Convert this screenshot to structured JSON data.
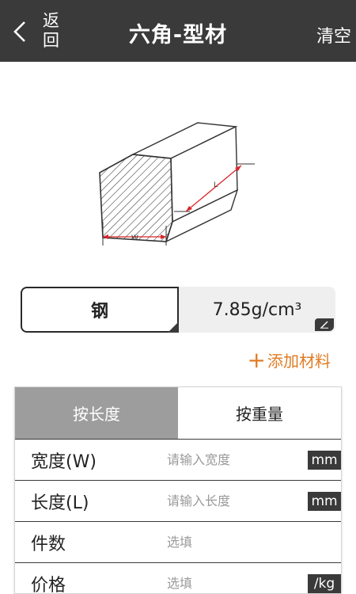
{
  "header": {
    "back_label": "返回",
    "title": "六角-型材",
    "clear_label": "清空"
  },
  "diagram": {
    "width_label": "W",
    "length_label": "L"
  },
  "material": {
    "name": "钢",
    "density": "7.85g/cm³"
  },
  "add_material_label": "添加材料",
  "tabs": [
    {
      "label": "按长度",
      "active": true
    },
    {
      "label": "按重量",
      "active": false
    }
  ],
  "fields": [
    {
      "label": "宽度(W)",
      "placeholder": "请输入宽度",
      "unit": "mm"
    },
    {
      "label": "长度(L)",
      "placeholder": "请输入长度",
      "unit": "mm"
    },
    {
      "label": "件数",
      "placeholder": "选填"
    },
    {
      "label": "价格",
      "placeholder": "选填",
      "unit": "/kg"
    }
  ],
  "colors": {
    "header_bg": "#3a3a3a",
    "accent": "#e07b22",
    "active_tab": "#9d9d9d",
    "dimension_red": "#d9262b"
  }
}
